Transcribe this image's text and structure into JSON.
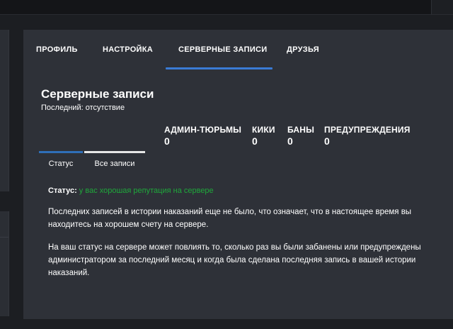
{
  "tabs": [
    {
      "label": "ПРОФИЛЬ"
    },
    {
      "label": "НАСТРОЙКА"
    },
    {
      "label": "СЕРВЕРНЫЕ ЗАПИСИ"
    },
    {
      "label": "ДРУЗЬЯ"
    }
  ],
  "section": {
    "title": "Серверные записи",
    "last_label": "Последний: отсутствие"
  },
  "stats": [
    {
      "label": "АДМИН-ТЮРЬМЫ",
      "value": "0"
    },
    {
      "label": "КИКИ",
      "value": "0"
    },
    {
      "label": "БАНЫ",
      "value": "0"
    },
    {
      "label": "ПРЕДУПРЕЖДЕНИЯ",
      "value": "0"
    }
  ],
  "subtabs": [
    {
      "label": "Статус"
    },
    {
      "label": "Все записи"
    }
  ],
  "status": {
    "key": "Статус:",
    "value": "у вас хорошая репутация на сервере"
  },
  "paragraphs": [
    "Последних записей в истории наказаний еще не было, что означает, что в настоящее время вы находитесь на хорошем счету на сервере.",
    "На ваш статус на сервере может повлиять то, сколько раз вы были забанены или предупреждены администратором за последний месяц и когда была сделана последняя запись в вашей истории наказаний."
  ],
  "colors": {
    "accent": "#3a7bd5",
    "status_good": "#1fa83b",
    "panel": "#2e3138",
    "background": "#1c1e22"
  }
}
